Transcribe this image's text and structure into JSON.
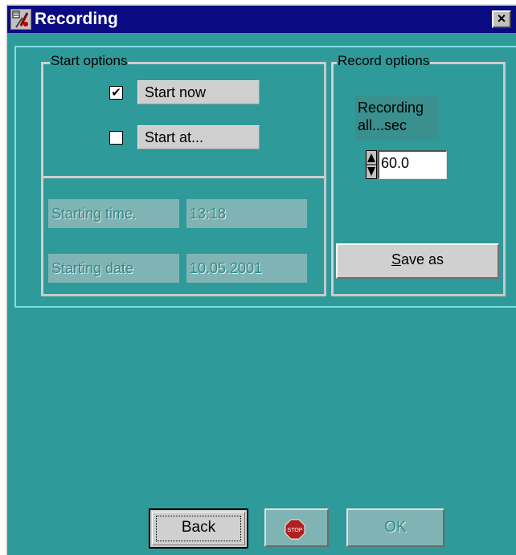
{
  "window": {
    "title": "Recording",
    "close_glyph": "×",
    "icon": "recording-app-icon"
  },
  "start_options": {
    "group_label": "Start options",
    "start_now": {
      "checked": true,
      "check_glyph": "✔",
      "label": "Start now"
    },
    "start_at": {
      "checked": false,
      "label": "Start at..."
    }
  },
  "schedule": {
    "starting_time_label": "Starting time.",
    "starting_time_value": "13:18",
    "starting_date_label": "Starting date",
    "starting_date_value": "10.05.2001"
  },
  "record_options": {
    "group_label": "Record options",
    "recording_label_line1": "Recording",
    "recording_label_line2": "all...sec",
    "interval_value": "60.0",
    "save_as_label_underlined": "S",
    "save_as_label_rest": "ave as"
  },
  "footer": {
    "back_label": "Back",
    "stop_icon_text": "STOP",
    "ok_label": "OK"
  },
  "colors": {
    "titlebar": "#0a0a82",
    "client": "#2e9a9a",
    "button_face": "#d0d0d0"
  }
}
